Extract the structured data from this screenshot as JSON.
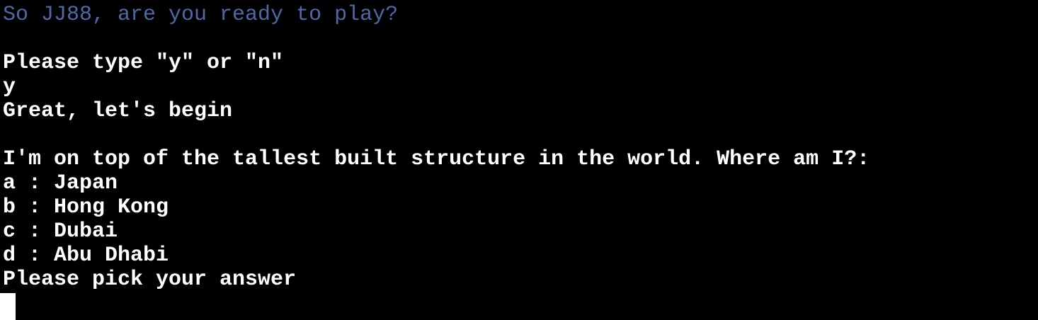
{
  "terminal": {
    "lines": {
      "l0": "So JJ88, are you ready to play?",
      "l2": "Please type \"y\" or \"n\"",
      "l3": "y",
      "l4": "Great, let's begin",
      "l6": "I'm on top of the tallest built structure in the world. Where am I?:",
      "l7": "a : Japan",
      "l8": "b : Hong Kong",
      "l9": "c : Dubai",
      "l10": "d : Abu Dhabi",
      "l11": "Please pick your answer"
    },
    "colors": {
      "background": "#000000",
      "text": "#ffffff",
      "prompt_text": "#4a6aa8"
    }
  }
}
